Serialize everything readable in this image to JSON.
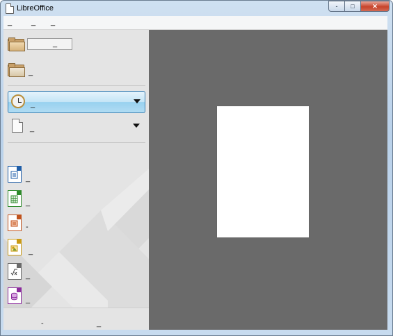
{
  "window": {
    "title": "LibreOffice"
  },
  "caption_buttons": {
    "minimize": "-",
    "maximize": "□",
    "close": "✕"
  },
  "menu": [
    {
      "label": "_"
    },
    {
      "label": "_"
    },
    {
      "label": "_"
    }
  ],
  "sidebar": {
    "open_file_label": "_",
    "remote_files_label": "_",
    "recent_files_label": "_",
    "templates_label": "_",
    "create": [
      {
        "label": "_",
        "icon": "writer-document-icon",
        "color": "#1f5ea8"
      },
      {
        "label": "_",
        "icon": "calc-spreadsheet-icon",
        "color": "#2d8a2a"
      },
      {
        "label": "-",
        "icon": "impress-presentation-icon",
        "color": "#c0521c"
      },
      {
        "label": "_",
        "icon": "draw-drawing-icon",
        "color": "#c99a15"
      },
      {
        "label": "_",
        "icon": "math-formula-icon",
        "color": "#6a6a6a"
      },
      {
        "label": "_",
        "icon": "base-database-icon",
        "color": "#8a2a9c"
      }
    ],
    "bottom": {
      "help_label": "-",
      "extensions_label": "_"
    }
  },
  "colors": {
    "accent": "#3c7fb1",
    "sidebar_bg": "#e4e4e4",
    "preview_bg": "#6a6a6a"
  }
}
